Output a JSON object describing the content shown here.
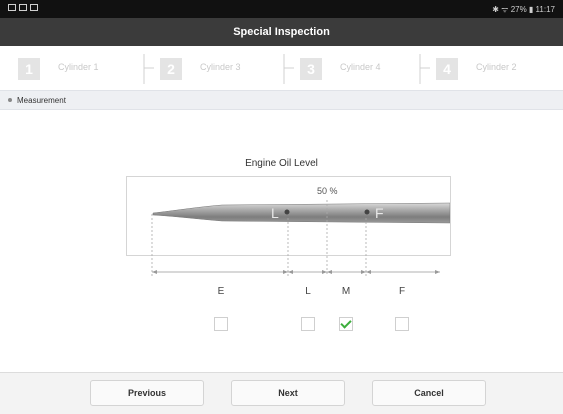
{
  "status_bar": {
    "right_text": "✱ ᯤ 27% ▮ 11:17"
  },
  "title": "Special Inspection",
  "steps": [
    {
      "number": "1",
      "label": "Cylinder 1"
    },
    {
      "number": "2",
      "label": "Cylinder 3"
    },
    {
      "number": "3",
      "label": "Cylinder 4"
    },
    {
      "number": "4",
      "label": "Cylinder 2"
    }
  ],
  "section": {
    "label": "Measurement"
  },
  "gauge": {
    "title": "Engine Oil Level",
    "percent_label": "50 %",
    "level_percent": 50,
    "stick_marks": [
      "L",
      "F"
    ]
  },
  "markers": [
    {
      "label": "E",
      "checked": false
    },
    {
      "label": "L",
      "checked": false
    },
    {
      "label": "M",
      "checked": true
    },
    {
      "label": "F",
      "checked": false
    }
  ],
  "footer": {
    "previous_label": "Previous",
    "next_label": "Next",
    "cancel_label": "Cancel"
  },
  "colors": {
    "title_bar": "#3b3b3b",
    "check_mark": "#3cae3c",
    "step_inactive": "#e4e4e4"
  }
}
